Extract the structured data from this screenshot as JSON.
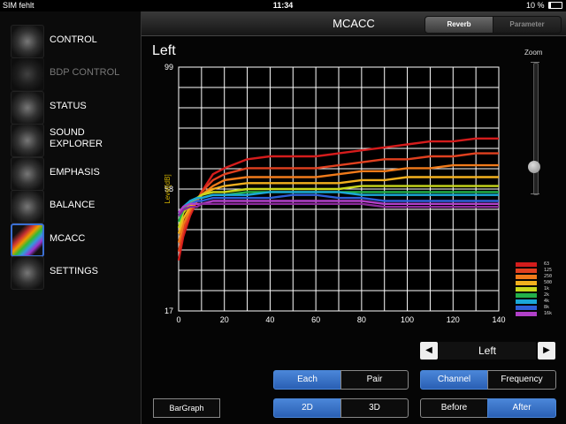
{
  "statusbar": {
    "carrier": "SIM fehlt",
    "time": "11:34",
    "battery": "10 %"
  },
  "sidebar": {
    "items": [
      {
        "label": "CONTROL",
        "state": "normal"
      },
      {
        "label": "BDP CONTROL",
        "state": "disabled"
      },
      {
        "label": "STATUS",
        "state": "normal"
      },
      {
        "label": "SOUND EXPLORER",
        "label_line1": "SOUND",
        "label_line2": "EXPLORER",
        "state": "normal"
      },
      {
        "label": "EMPHASIS",
        "state": "normal"
      },
      {
        "label": "BALANCE",
        "state": "normal"
      },
      {
        "label": "MCACC",
        "state": "active"
      },
      {
        "label": "SETTINGS",
        "state": "normal"
      }
    ]
  },
  "header": {
    "title": "MCACC",
    "tabs": [
      "Reverb",
      "Parameter"
    ],
    "active_tab": "Reverb"
  },
  "main": {
    "channel_title": "Left",
    "zoom_label": "Zoom",
    "zoom_level": 0.21,
    "channel_selector": {
      "value": "Left",
      "prev": "◀",
      "next": "▶"
    },
    "buttons": {
      "each": "Each",
      "pair": "Pair",
      "channel": "Channel",
      "frequency": "Frequency",
      "bargraph": "BarGraph",
      "two_d": "2D",
      "three_d": "3D",
      "before": "Before",
      "after": "After"
    },
    "active": {
      "each_pair": "Each",
      "channel_freq": "Channel",
      "dimension": "2D",
      "before_after": "After"
    }
  },
  "colors": {
    "accent": "#3b78d0",
    "grid": "#ffffff",
    "axis_label": "#d4b400"
  },
  "chart_data": {
    "type": "line",
    "ylabel": "Level[dB]",
    "ylim": [
      17,
      99
    ],
    "xlim": [
      0,
      140
    ],
    "y_ticks": [
      17,
      58,
      99
    ],
    "x_ticks": [
      0,
      20,
      40,
      60,
      80,
      100,
      120,
      140
    ],
    "x_grid_step": 10,
    "grid": true,
    "legend_position": "bottom-right",
    "x": [
      0,
      2,
      5,
      8,
      10,
      15,
      20,
      30,
      40,
      50,
      60,
      70,
      80,
      90,
      100,
      110,
      120,
      130,
      140
    ],
    "series": [
      {
        "name": "63",
        "color": "#d41c1c",
        "values": [
          34,
          42,
          49,
          54,
          57,
          63,
          65,
          68,
          69,
          69,
          69,
          70,
          71,
          72,
          73,
          74,
          74,
          75,
          75
        ]
      },
      {
        "name": "125",
        "color": "#e0401f",
        "values": [
          37,
          44,
          50,
          54,
          57,
          61,
          63,
          65,
          65,
          65,
          65,
          66,
          67,
          68,
          68,
          69,
          69,
          70,
          70
        ]
      },
      {
        "name": "250",
        "color": "#f07a1a",
        "values": [
          40,
          46,
          51,
          54,
          56,
          59,
          61,
          62,
          62,
          62,
          62,
          63,
          64,
          64,
          65,
          65,
          66,
          66,
          66
        ]
      },
      {
        "name": "500",
        "color": "#f2b01e",
        "values": [
          43,
          48,
          52,
          55,
          56,
          58,
          59,
          60,
          60,
          60,
          60,
          60,
          61,
          61,
          62,
          62,
          62,
          62,
          62
        ]
      },
      {
        "name": "1k",
        "color": "#c8d81c",
        "values": [
          45,
          50,
          53,
          55,
          56,
          57,
          57,
          58,
          58,
          58,
          58,
          58,
          59,
          59,
          59,
          59,
          59,
          59,
          59
        ]
      },
      {
        "name": "2k",
        "color": "#22b04a",
        "values": [
          47,
          51,
          54,
          55,
          55,
          56,
          56,
          57,
          57,
          57,
          57,
          57,
          57,
          57,
          57,
          57,
          57,
          57,
          57
        ]
      },
      {
        "name": "4k",
        "color": "#1aa8d8",
        "values": [
          49,
          52,
          54,
          55,
          55,
          56,
          56,
          56,
          57,
          57,
          57,
          57,
          56,
          56,
          56,
          56,
          56,
          56,
          56
        ]
      },
      {
        "name": "8k",
        "color": "#2f5fd8",
        "values": [
          50,
          52,
          53,
          54,
          54,
          55,
          55,
          55,
          55,
          56,
          56,
          55,
          55,
          54,
          54,
          54,
          54,
          54,
          54
        ]
      },
      {
        "name": "16k",
        "color": "#b040c8",
        "values": [
          50,
          52,
          53,
          53,
          53,
          54,
          54,
          54,
          54,
          54,
          54,
          54,
          54,
          53,
          53,
          53,
          53,
          53,
          53
        ]
      },
      {
        "name": "",
        "color": "#8a2a9a",
        "values": [
          49,
          51,
          52,
          52,
          53,
          53,
          53,
          53,
          53,
          53,
          53,
          53,
          53,
          52,
          52,
          52,
          52,
          52,
          52
        ]
      }
    ],
    "legend": [
      {
        "label": "63",
        "color": "#d41c1c"
      },
      {
        "label": "125",
        "color": "#e0401f"
      },
      {
        "label": "250",
        "color": "#f07a1a"
      },
      {
        "label": "500",
        "color": "#f2b01e"
      },
      {
        "label": "1k",
        "color": "#c8d81c"
      },
      {
        "label": "2k",
        "color": "#22b04a"
      },
      {
        "label": "4k",
        "color": "#1aa8d8"
      },
      {
        "label": "8k",
        "color": "#2f5fd8"
      },
      {
        "label": "16k",
        "color": "#b040c8"
      }
    ]
  }
}
